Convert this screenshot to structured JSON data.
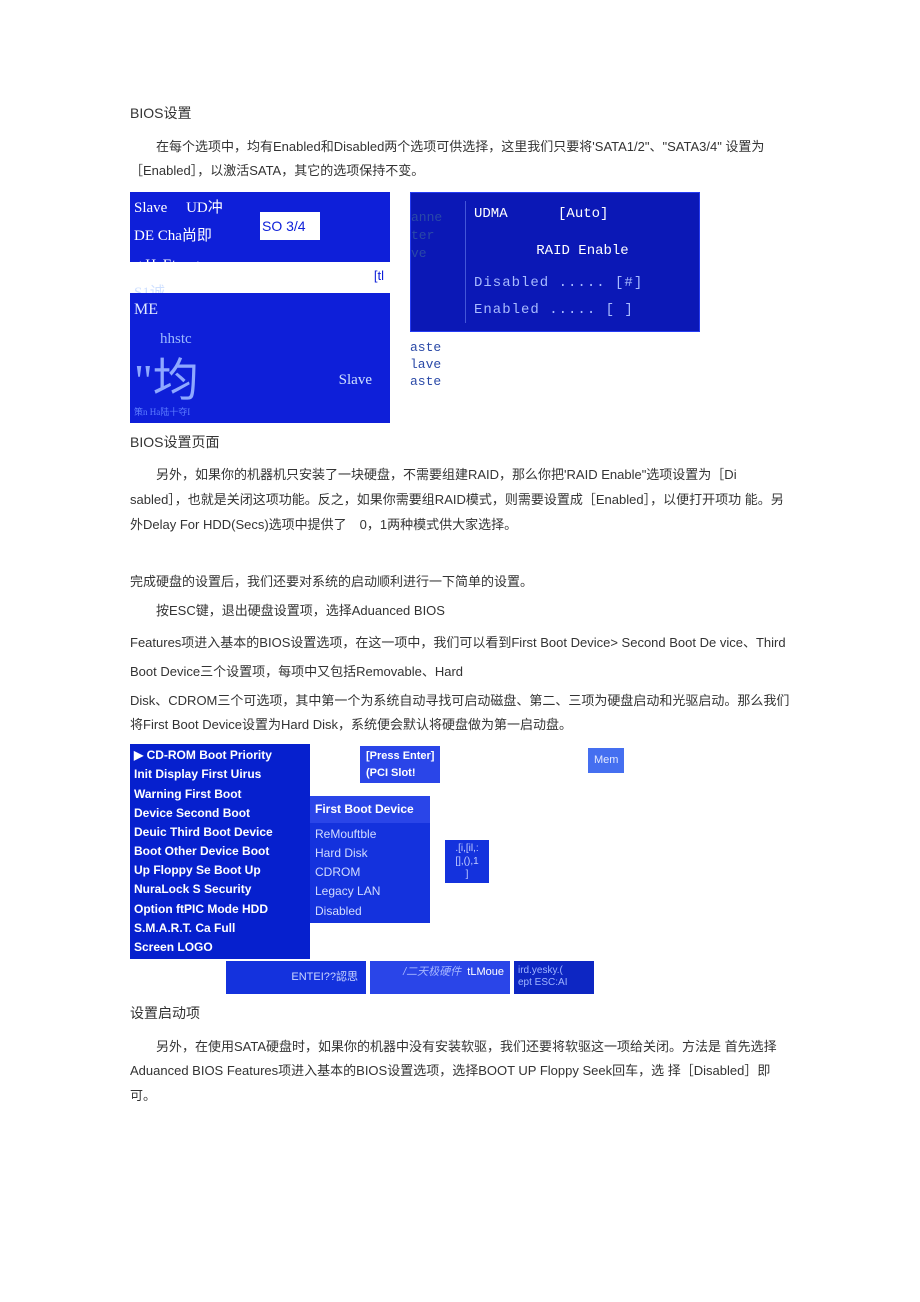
{
  "header": {
    "title": "BIOS设置"
  },
  "p1": "在每个选项中，均有Enabled和Disabled两个选项可供选择，这里我们只要将'SATA1/2\"、\"SATA3/4\" 设置为 ［Enabled］，以激活SATA，其它的选项保持不变。",
  "fig1": {
    "left_top": {
      "row1": "Slave",
      "row1b": "UD冲",
      "row2": "DE Cha尚即",
      "row3a": "g HaEtcr g",
      "row3b": "SO 3/4",
      "row4": "S1诚"
    },
    "left_mid": "[tl",
    "left_bot": {
      "me": "ME",
      "hhstc": "hhstc",
      "big": "\"均",
      "slave": "Slave",
      "tiny": "策n Ha陆十夺I"
    },
    "right": {
      "hdr_left": "UDMA",
      "hdr_right": "[Auto]",
      "side": [
        "anne",
        "ter",
        "ve"
      ],
      "raid_title": "RAID Enable",
      "opt1": "Disabled  .....  [#]",
      "opt2": "Enabled   .....  [ ]",
      "lower": [
        "aste",
        "lave",
        "aste"
      ]
    }
  },
  "caption1": "BIOS设置页面",
  "p2": "另外，如果你的机器机只安装了一块硬盘，不需要组建RAID，那么你把'RAID Enable\"选项设置为［Di sabled］，也就是关闭这项功能。反之，如果你需要组RAID模式，则需要设置成［Enabled］，以便打开项功 能。另外Delay For HDD(Secs)选项中提供了　0，1两种模式供大家选择。",
  "p3": "完成硬盘的设置后，我们还要对系统的启动顺利进行一下简单的设置。",
  "p4": "按ESC键，退出硬盘设置项，选择Aduanced BIOS",
  "p5": "Features项进入基本的BIOS设置选项，在这一项中，我们可以看到First Boot Device> Second Boot De vice、Third",
  "p6": "Boot Device三个设置项，每项中又包括Removable、Hard",
  "p7": "Disk、CDROM三个可选项，其中第一个为系统自动寻找可启动磁盘、第二、三项为硬盘启动和光驱启动。那么我们将First Boot Device设置为Hard Disk，系统便会默认将硬盘做为第一启动盘。",
  "fig2": {
    "labels": [
      "▶  CD-ROM Boot Priority",
      "Init Display First Uirus",
      "Warning First Boot",
      "Device Second Boot",
      "Deuic Third Boot Device",
      "Boot Other Device Boot",
      "Up Floppy Se Boot Up",
      "NuraLock S Security",
      "Option ftPIC Mode HDD",
      "S.M.A.R.T. Ca Full",
      "Screen LOGO"
    ],
    "top_right": [
      "[Press Enter]",
      "(PCI Slot!"
    ],
    "mem": "Mem",
    "sel_title": "First Boot Device",
    "options": [
      "ReMouftble",
      "Hard Disk",
      "CDROM",
      "Legacy LAN",
      "Disabled"
    ],
    "side_badge": [
      ".[i,[il,:",
      "[],(),1",
      "]"
    ],
    "footer": {
      "f1": "ENTEI??認思",
      "f2_l1": "/二天极硬件",
      "f2_r": "tLMoue",
      "f3_l1": "ird.yesky.(",
      "f3_l2": "ept  ESC:AI"
    }
  },
  "caption2": "设置启动项",
  "p8": "另外，在使用SATA硬盘时，如果你的机器中没有安装软驱，我们还要将软驱这一项给关闭。方法是 首先选择Aduanced BIOS Features项进入基本的BIOS设置选项，选择BOOT UP Floppy Seek回车，选 择［Disabled］即可。"
}
